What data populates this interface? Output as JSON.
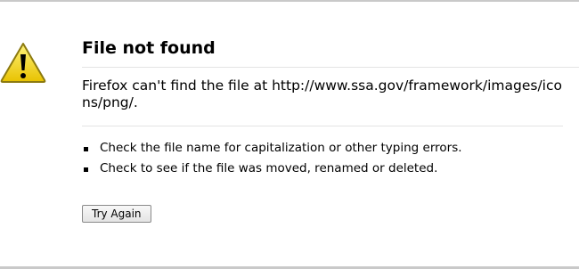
{
  "error": {
    "title": "File not found",
    "description": "Firefox can't find the file at http://www.ssa.gov/framework/images/icons/png/.",
    "hints": [
      "Check the file name for capitalization or other typing errors.",
      "Check to see if the file was moved, renamed or deleted."
    ],
    "try_again_label": "Try Again",
    "icon": "warning-icon"
  },
  "colors": {
    "icon_fill": "#f2d21c",
    "icon_border": "#8c7a10",
    "divider": "#e3e3e3"
  }
}
